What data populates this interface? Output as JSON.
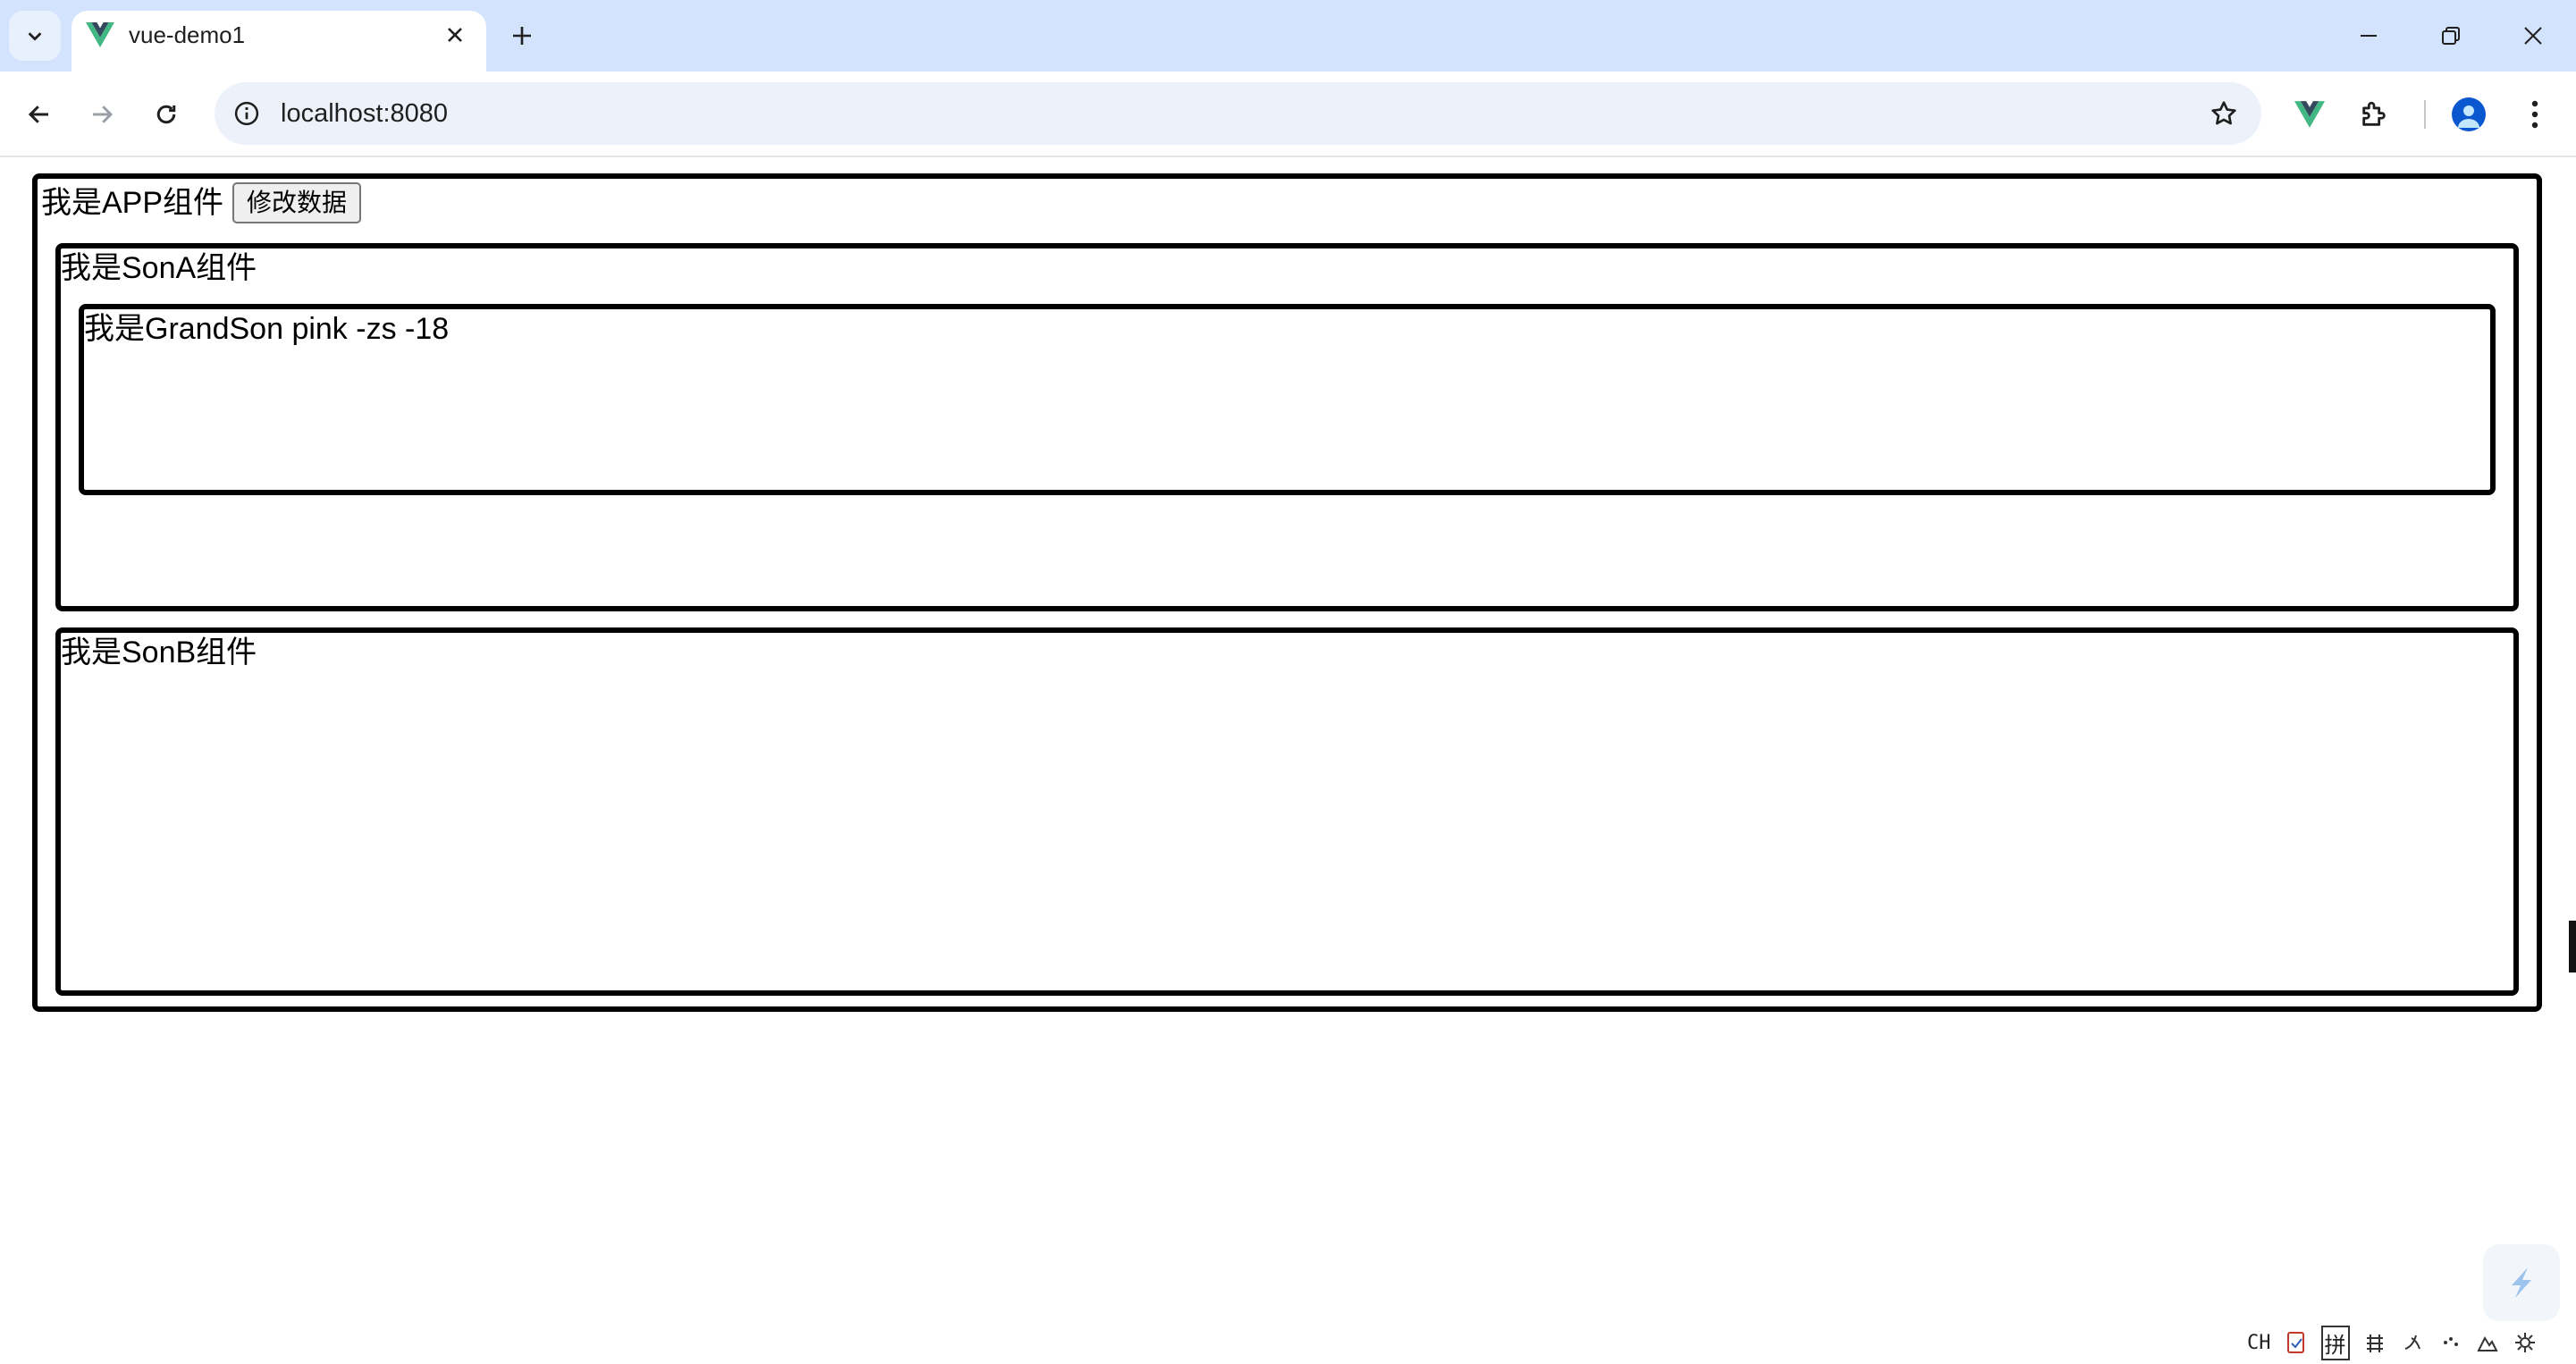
{
  "browser": {
    "tab_title": "vue-demo1",
    "url": "localhost:8080",
    "colors": {
      "tabstrip": "#d3e3fd",
      "omnibox": "#edf2fa",
      "vue_green": "#41b883",
      "vue_dark": "#35495e",
      "profile": "#0b57d0"
    },
    "icons": [
      "tab-search-icon",
      "vue-favicon-icon",
      "close-icon",
      "plus-icon",
      "minimize-icon",
      "restore-icon",
      "window-close-icon",
      "back-arrow-icon",
      "forward-arrow-icon",
      "reload-icon",
      "site-info-icon",
      "star-icon",
      "vue-devtools-icon",
      "extensions-icon",
      "profile-icon",
      "kebab-menu-icon"
    ]
  },
  "page": {
    "app": {
      "label": "我是APP组件",
      "button_label": "修改数据"
    },
    "son_a": {
      "label": "我是SonA组件"
    },
    "grandson": {
      "label": "我是GrandSon pink -zs -18"
    },
    "son_b": {
      "label": "我是SonB组件"
    }
  },
  "tray": {
    "ime_label": "CH",
    "pinyin_label": "拼"
  }
}
